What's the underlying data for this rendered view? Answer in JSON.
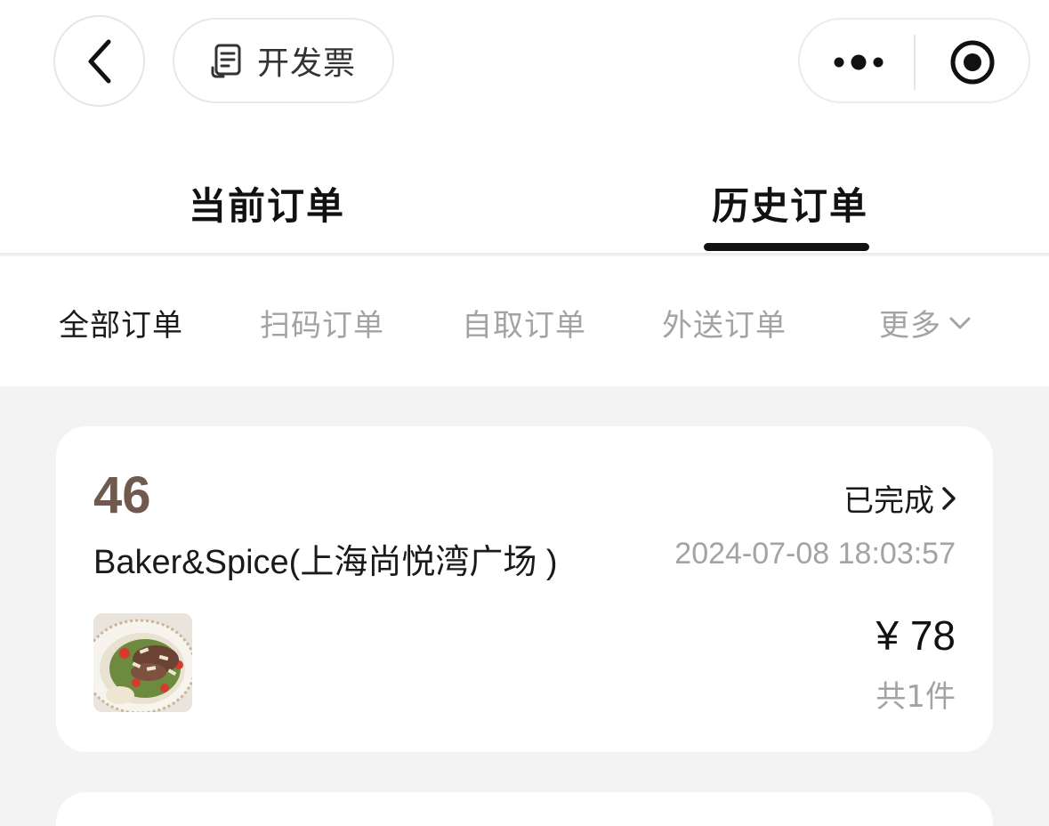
{
  "header": {
    "back_icon": "chevron-left-icon",
    "invoice_icon": "receipt-icon",
    "invoice_label": "开发票",
    "more_icon": "more-dots-icon",
    "close_icon": "target-circle-icon"
  },
  "tabs": [
    {
      "label": "当前订单",
      "selected": false
    },
    {
      "label": "历史订单",
      "selected": true
    }
  ],
  "filters": [
    {
      "label": "全部订单",
      "active": true
    },
    {
      "label": "扫码订单",
      "active": false
    },
    {
      "label": "自取订单",
      "active": false
    },
    {
      "label": "外送订单",
      "active": false
    },
    {
      "label": "更多",
      "active": false
    }
  ],
  "orders": [
    {
      "number": "46",
      "status": "已完成",
      "store": "Baker&Spice(上海尚悦湾广场 )",
      "time": "2024-07-08 18:03:57",
      "price": "¥ 78",
      "count": "共1件",
      "thumbnail": "salad-bowl-image"
    }
  ],
  "colors": {
    "accent_dark": "#111111",
    "order_number": "#6f5a4d",
    "muted": "#a3a3a3",
    "background": "#f3f3f3"
  }
}
